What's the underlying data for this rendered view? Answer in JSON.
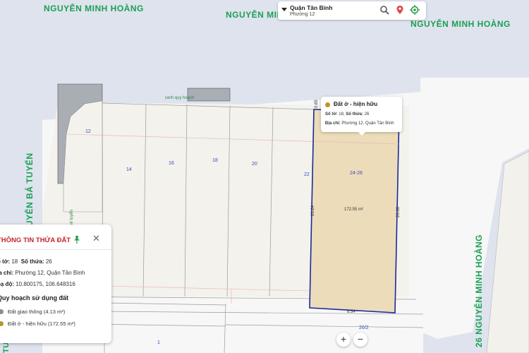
{
  "streets": {
    "top_left": "NGUYỄN MINH HOÀNG",
    "top_center": "NGUYỄN MINH HOÀNG",
    "top_right": "NGUYỄN MINH HOÀNG",
    "left_vertical": "NGUYỄN BÁ TUYỂN",
    "right_vertical": "26 NGUYỄN MINH HOÀNG",
    "bottom_left_fragment": "TU"
  },
  "search": {
    "district": "Quận Tân Bình",
    "ward": "Phường 12"
  },
  "map_labels": {
    "planning_boundary": "ranh quy hoạch",
    "lots": [
      "12",
      "14",
      "16",
      "18",
      "20",
      "22",
      "24-26",
      "26/2",
      "1"
    ],
    "area": "172.55 m²",
    "dim_left": "20.24",
    "dim_right": "20.36",
    "dim_bottom": "8.54",
    "dim_top": "0.65",
    "alley_fragment": "bê tuyển"
  },
  "popup": {
    "title": "Đất ở - hiện hữu",
    "sheet_label": "Số tờ:",
    "sheet_value": "18,",
    "parcel_label": "Số thửa:",
    "parcel_value": "26",
    "address_label": "Địa chỉ:",
    "address_value": "Phường 12, Quận Tân Bình"
  },
  "panel": {
    "title": "THÔNG TIN THỬA ĐẤT",
    "sheet_label": "ố tờ:",
    "sheet_value": "18",
    "parcel_label": "Số thửa:",
    "parcel_value": "26",
    "address_label": "ịa chỉ:",
    "address_value": "Phường 12, Quận Tân Bình",
    "coord_label": "oạ độ:",
    "coord_value": "10.800175, 106.648316",
    "section_title": "Quy hoạch sử dụng đất",
    "legend": [
      {
        "label": "Đất giao thông (4.13 m²)",
        "color": "#8c8c8c"
      },
      {
        "label": "Đất ở - hiện hữu (172.55 m²)",
        "color": "#b8962c"
      }
    ]
  },
  "zoom": {
    "in": "+",
    "out": "−"
  },
  "colors": {
    "street_text": "#1aa053",
    "selected_parcel": "#ecdcba",
    "parcel_outline": "#1a2a9a",
    "panel_title": "#c3262b"
  }
}
